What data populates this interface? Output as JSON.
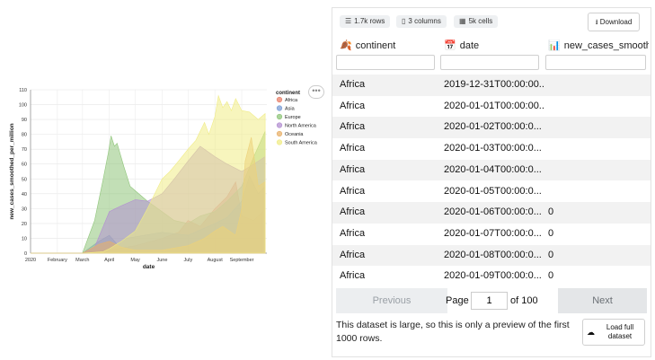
{
  "chart_data": {
    "type": "area",
    "title": "",
    "xlabel": "date",
    "ylabel": "new_cases_smoothed_per_million",
    "ylim": [
      0,
      110
    ],
    "y_ticks": [
      0,
      10,
      20,
      30,
      40,
      50,
      60,
      70,
      80,
      90,
      100,
      110
    ],
    "x_ticks": [
      "2020",
      "February",
      "March",
      "April",
      "May",
      "June",
      "July",
      "August",
      "September"
    ],
    "legend": {
      "title": "continent",
      "placement": "top-right"
    },
    "grid": true,
    "series": [
      {
        "name": "Africa",
        "color": "#e8806a",
        "points": [
          [
            "2020-01-01",
            0
          ],
          [
            "2020-03-01",
            0
          ],
          [
            "2020-04-01",
            2
          ],
          [
            "2020-05-01",
            5
          ],
          [
            "2020-06-01",
            10
          ],
          [
            "2020-06-20",
            14
          ],
          [
            "2020-07-01",
            22
          ],
          [
            "2020-07-15",
            18
          ],
          [
            "2020-08-01",
            30
          ],
          [
            "2020-08-15",
            38
          ],
          [
            "2020-08-25",
            48
          ],
          [
            "2020-09-01",
            25
          ],
          [
            "2020-09-15",
            22
          ],
          [
            "2020-09-25",
            28
          ]
        ]
      },
      {
        "name": "Asia",
        "color": "#7b9ed6",
        "points": [
          [
            "2020-01-01",
            0
          ],
          [
            "2020-03-01",
            0
          ],
          [
            "2020-03-20",
            8
          ],
          [
            "2020-04-01",
            12
          ],
          [
            "2020-04-10",
            6
          ],
          [
            "2020-04-20",
            10
          ],
          [
            "2020-05-01",
            11
          ],
          [
            "2020-06-01",
            14
          ],
          [
            "2020-07-01",
            12
          ],
          [
            "2020-08-01",
            20
          ],
          [
            "2020-08-15",
            24
          ],
          [
            "2020-09-01",
            35
          ],
          [
            "2020-09-10",
            52
          ],
          [
            "2020-09-20",
            40
          ],
          [
            "2020-09-28",
            45
          ]
        ]
      },
      {
        "name": "Europe",
        "color": "#8fc57a",
        "points": [
          [
            "2020-01-01",
            0
          ],
          [
            "2020-03-01",
            0
          ],
          [
            "2020-03-15",
            22
          ],
          [
            "2020-03-25",
            50
          ],
          [
            "2020-03-31",
            68
          ],
          [
            "2020-04-03",
            79
          ],
          [
            "2020-04-07",
            72
          ],
          [
            "2020-04-10",
            74
          ],
          [
            "2020-04-18",
            58
          ],
          [
            "2020-04-25",
            45
          ],
          [
            "2020-05-01",
            42
          ],
          [
            "2020-05-15",
            35
          ],
          [
            "2020-06-01",
            28
          ],
          [
            "2020-06-15",
            22
          ],
          [
            "2020-07-01",
            20
          ],
          [
            "2020-07-15",
            25
          ],
          [
            "2020-08-01",
            28
          ],
          [
            "2020-08-15",
            35
          ],
          [
            "2020-09-01",
            45
          ],
          [
            "2020-09-15",
            65
          ],
          [
            "2020-09-28",
            82
          ]
        ]
      },
      {
        "name": "North America",
        "color": "#b38fd1",
        "points": [
          [
            "2020-01-01",
            0
          ],
          [
            "2020-03-01",
            0
          ],
          [
            "2020-03-15",
            4
          ],
          [
            "2020-03-25",
            18
          ],
          [
            "2020-04-01",
            28
          ],
          [
            "2020-04-15",
            32
          ],
          [
            "2020-05-01",
            36
          ],
          [
            "2020-05-15",
            35
          ],
          [
            "2020-06-01",
            40
          ],
          [
            "2020-06-15",
            50
          ],
          [
            "2020-07-01",
            62
          ],
          [
            "2020-07-15",
            72
          ],
          [
            "2020-08-01",
            65
          ],
          [
            "2020-08-15",
            60
          ],
          [
            "2020-09-01",
            55
          ],
          [
            "2020-09-15",
            60
          ],
          [
            "2020-09-28",
            65
          ]
        ]
      },
      {
        "name": "Oceania",
        "color": "#e8b06a",
        "points": [
          [
            "2020-01-01",
            0
          ],
          [
            "2020-03-01",
            0
          ],
          [
            "2020-03-20",
            6
          ],
          [
            "2020-04-01",
            8
          ],
          [
            "2020-04-15",
            4
          ],
          [
            "2020-05-01",
            2
          ],
          [
            "2020-06-01",
            2
          ],
          [
            "2020-07-01",
            5
          ],
          [
            "2020-07-20",
            10
          ],
          [
            "2020-08-01",
            15
          ],
          [
            "2020-08-10",
            18
          ],
          [
            "2020-08-25",
            12
          ],
          [
            "2020-09-01",
            30
          ],
          [
            "2020-09-05",
            62
          ],
          [
            "2020-09-12",
            78
          ],
          [
            "2020-09-20",
            45
          ],
          [
            "2020-09-28",
            48
          ]
        ]
      },
      {
        "name": "South America",
        "color": "#f0ec86",
        "points": [
          [
            "2020-01-01",
            0
          ],
          [
            "2020-03-01",
            0
          ],
          [
            "2020-03-25",
            1
          ],
          [
            "2020-04-01",
            3
          ],
          [
            "2020-04-15",
            8
          ],
          [
            "2020-05-01",
            15
          ],
          [
            "2020-05-15",
            30
          ],
          [
            "2020-06-01",
            50
          ],
          [
            "2020-06-10",
            55
          ],
          [
            "2020-06-20",
            62
          ],
          [
            "2020-07-01",
            70
          ],
          [
            "2020-07-10",
            76
          ],
          [
            "2020-07-20",
            88
          ],
          [
            "2020-07-25",
            80
          ],
          [
            "2020-08-01",
            92
          ],
          [
            "2020-08-05",
            106
          ],
          [
            "2020-08-10",
            98
          ],
          [
            "2020-08-15",
            102
          ],
          [
            "2020-08-20",
            96
          ],
          [
            "2020-08-25",
            104
          ],
          [
            "2020-09-01",
            96
          ],
          [
            "2020-09-10",
            95
          ],
          [
            "2020-09-20",
            90
          ],
          [
            "2020-09-28",
            94
          ]
        ]
      }
    ]
  },
  "chart_more_label": "•••",
  "table": {
    "chips": [
      {
        "icon": "☰",
        "label": "1.7k rows"
      },
      {
        "icon": "▯",
        "label": "3 columns"
      },
      {
        "icon": "▦",
        "label": "5k cells"
      }
    ],
    "download_label": "Download",
    "download_icon": "⭳",
    "columns": [
      {
        "icon": "🍂",
        "name": "continent"
      },
      {
        "icon": "📅",
        "name": "date"
      },
      {
        "icon": "📊",
        "name": "new_cases_smoothed"
      }
    ],
    "rows": [
      [
        "Africa",
        "2019-12-31T00:00:00...",
        ""
      ],
      [
        "Africa",
        "2020-01-01T00:00:00...",
        ""
      ],
      [
        "Africa",
        "2020-01-02T00:00:0...",
        ""
      ],
      [
        "Africa",
        "2020-01-03T00:00:0...",
        ""
      ],
      [
        "Africa",
        "2020-01-04T00:00:0...",
        ""
      ],
      [
        "Africa",
        "2020-01-05T00:00:0...",
        ""
      ],
      [
        "Africa",
        "2020-01-06T00:00:0...",
        "0"
      ],
      [
        "Africa",
        "2020-01-07T00:00:0...",
        "0"
      ],
      [
        "Africa",
        "2020-01-08T00:00:0...",
        "0"
      ],
      [
        "Africa",
        "2020-01-09T00:00:0...",
        "0"
      ]
    ],
    "pager": {
      "previous": "Previous",
      "page_label": "Page",
      "page_value": "1",
      "of_label": "of 100",
      "next": "Next"
    },
    "notice": "This dataset is large, so this is only a preview of the first 1000 rows.",
    "load_full_label": "Load full dataset",
    "load_icon": "☁"
  }
}
